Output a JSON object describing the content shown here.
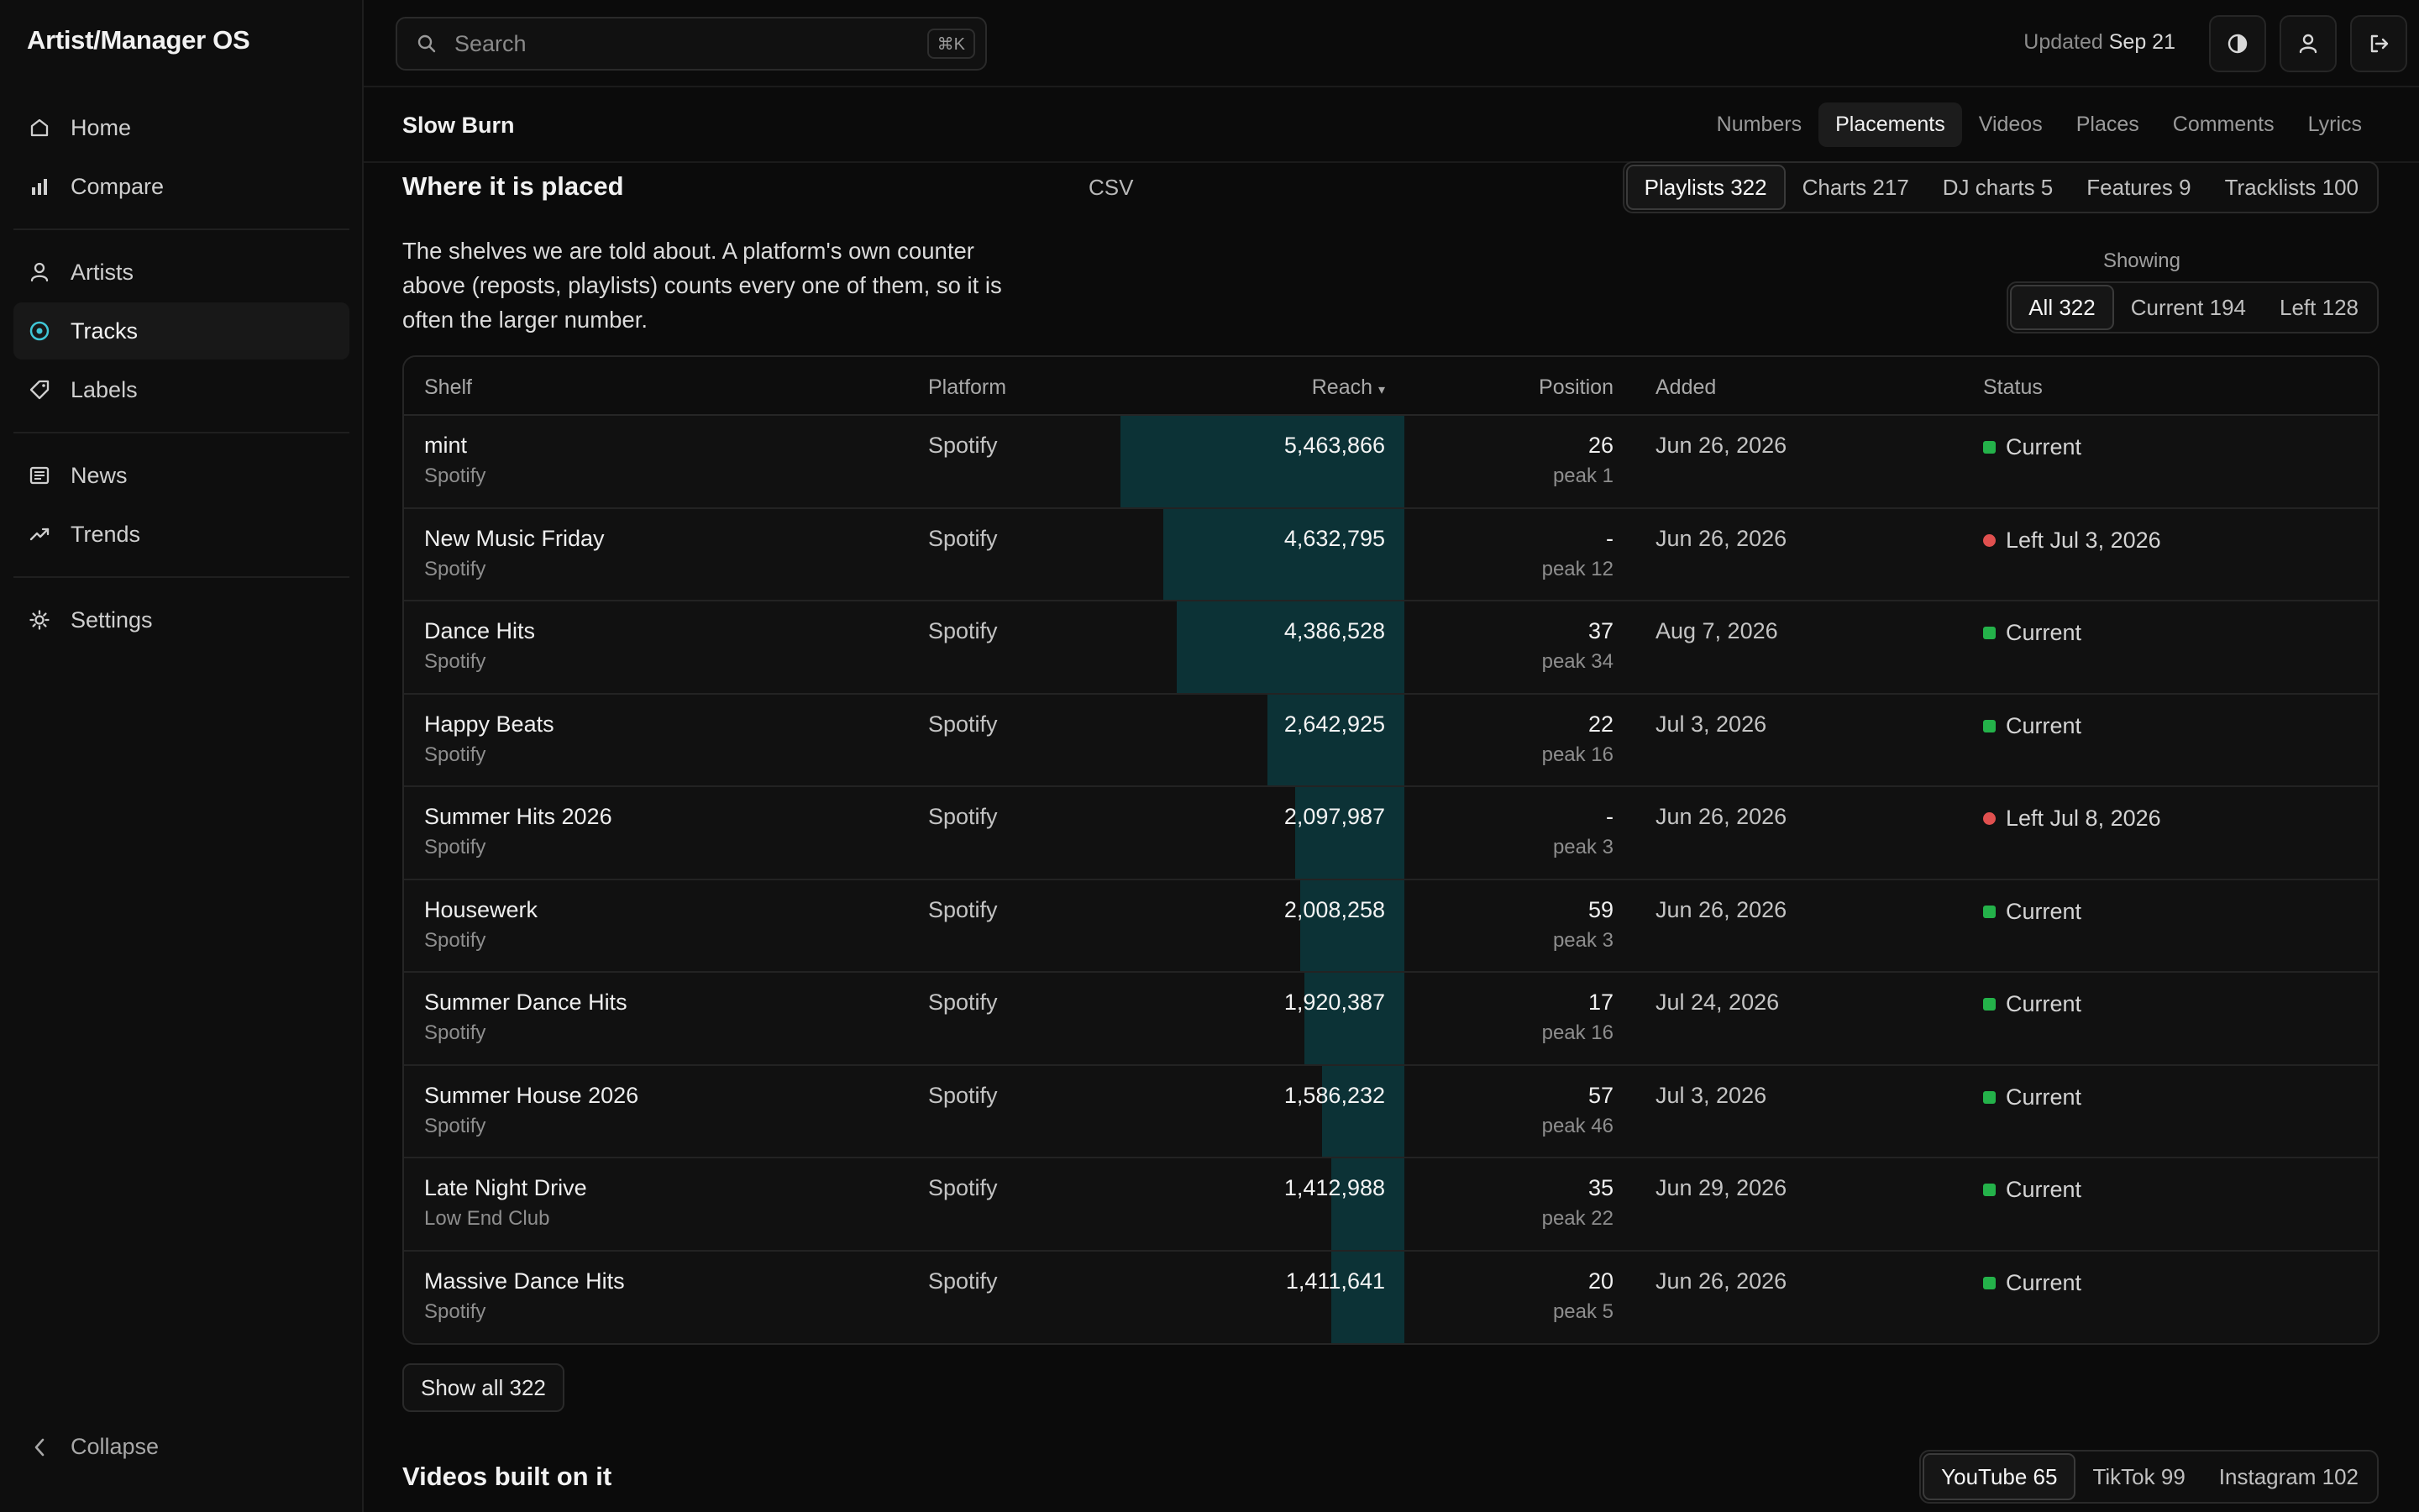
{
  "app": {
    "title": "Artist/Manager OS"
  },
  "sidebar": {
    "groups": [
      [
        {
          "label": "Home",
          "icon": "home-icon"
        },
        {
          "label": "Compare",
          "icon": "bar-chart-icon"
        }
      ],
      [
        {
          "label": "Artists",
          "icon": "user-icon"
        },
        {
          "label": "Tracks",
          "icon": "disc-icon",
          "active": true
        },
        {
          "label": "Labels",
          "icon": "tag-icon"
        }
      ],
      [
        {
          "label": "News",
          "icon": "newspaper-icon"
        },
        {
          "label": "Trends",
          "icon": "trend-icon"
        }
      ],
      [
        {
          "label": "Settings",
          "icon": "gear-icon"
        }
      ]
    ],
    "collapse_label": "Collapse"
  },
  "topbar": {
    "search_placeholder": "Search",
    "shortcut": "⌘K",
    "updated_prefix": "Updated",
    "updated_date": "Sep 21"
  },
  "track": {
    "title": "Slow Burn",
    "tabs": [
      "Numbers",
      "Placements",
      "Videos",
      "Places",
      "Comments",
      "Lyrics"
    ],
    "active_tab": "Placements"
  },
  "placements": {
    "heading": "Where it is placed",
    "csv_label": "CSV",
    "shelf_types": [
      "Playlists 322",
      "Charts 217",
      "DJ charts 5",
      "Features 9",
      "Tracklists 100"
    ],
    "active_shelf_type": "Playlists 322",
    "intro": "The shelves we are told about. A platform's own counter above (reposts, playlists) counts every one of them, so it is often the larger number.",
    "showing_label": "Showing",
    "filters": [
      "All 322",
      "Current 194",
      "Left 128"
    ],
    "active_filter": "All 322",
    "columns": {
      "shelf": "Shelf",
      "platform": "Platform",
      "reach": "Reach",
      "sort_indicator": "▾",
      "position": "Position",
      "added": "Added",
      "status": "Status"
    },
    "max_reach": 5463866,
    "rows": [
      {
        "name": "mint",
        "curator": "Spotify",
        "platform": "Spotify",
        "reach": "5,463,866",
        "reach_value": 5463866,
        "position": "26",
        "peak": "peak 1",
        "added": "Jun 26, 2026",
        "status": "Current",
        "status_type": "current"
      },
      {
        "name": "New Music Friday",
        "curator": "Spotify",
        "platform": "Spotify",
        "reach": "4,632,795",
        "reach_value": 4632795,
        "position": "-",
        "peak": "peak 12",
        "added": "Jun 26, 2026",
        "status": "Left Jul 3, 2026",
        "status_type": "left"
      },
      {
        "name": "Dance Hits",
        "curator": "Spotify",
        "platform": "Spotify",
        "reach": "4,386,528",
        "reach_value": 4386528,
        "position": "37",
        "peak": "peak 34",
        "added": "Aug 7, 2026",
        "status": "Current",
        "status_type": "current"
      },
      {
        "name": "Happy Beats",
        "curator": "Spotify",
        "platform": "Spotify",
        "reach": "2,642,925",
        "reach_value": 2642925,
        "position": "22",
        "peak": "peak 16",
        "added": "Jul 3, 2026",
        "status": "Current",
        "status_type": "current"
      },
      {
        "name": "Summer Hits 2026",
        "curator": "Spotify",
        "platform": "Spotify",
        "reach": "2,097,987",
        "reach_value": 2097987,
        "position": "-",
        "peak": "peak 3",
        "added": "Jun 26, 2026",
        "status": "Left Jul 8, 2026",
        "status_type": "left"
      },
      {
        "name": "Housewerk",
        "curator": "Spotify",
        "platform": "Spotify",
        "reach": "2,008,258",
        "reach_value": 2008258,
        "position": "59",
        "peak": "peak 3",
        "added": "Jun 26, 2026",
        "status": "Current",
        "status_type": "current"
      },
      {
        "name": "Summer Dance Hits",
        "curator": "Spotify",
        "platform": "Spotify",
        "reach": "1,920,387",
        "reach_value": 1920387,
        "position": "17",
        "peak": "peak 16",
        "added": "Jul 24, 2026",
        "status": "Current",
        "status_type": "current"
      },
      {
        "name": "Summer House 2026",
        "curator": "Spotify",
        "platform": "Spotify",
        "reach": "1,586,232",
        "reach_value": 1586232,
        "position": "57",
        "peak": "peak 46",
        "added": "Jul 3, 2026",
        "status": "Current",
        "status_type": "current"
      },
      {
        "name": "Late Night Drive",
        "curator": "Low End Club",
        "platform": "Spotify",
        "reach": "1,412,988",
        "reach_value": 1412988,
        "position": "35",
        "peak": "peak 22",
        "added": "Jun 29, 2026",
        "status": "Current",
        "status_type": "current"
      },
      {
        "name": "Massive Dance Hits",
        "curator": "Spotify",
        "platform": "Spotify",
        "reach": "1,411,641",
        "reach_value": 1411641,
        "position": "20",
        "peak": "peak 5",
        "added": "Jun 26, 2026",
        "status": "Current",
        "status_type": "current"
      }
    ],
    "show_all_label": "Show all 322"
  },
  "videos": {
    "heading": "Videos built on it",
    "platforms": [
      "YouTube 65",
      "TikTok 99",
      "Instagram 102"
    ],
    "active_platform": "YouTube 65"
  },
  "colors": {
    "reach_bar": "#0c3236",
    "current": "#24b24a",
    "left": "#e0504f",
    "accent_active_icon": "#3fc6d6"
  }
}
